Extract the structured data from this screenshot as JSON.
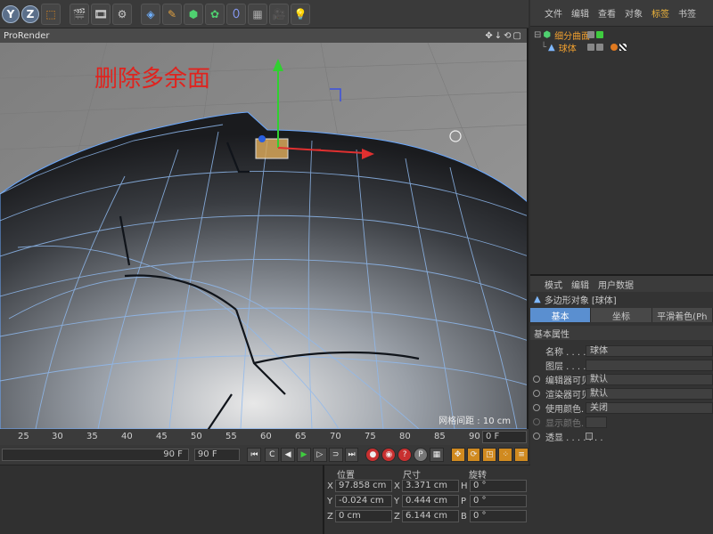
{
  "toolbar": {
    "buttons": [
      {
        "name": "y-axis-lock-button",
        "label": "Y"
      },
      {
        "name": "z-axis-lock-button",
        "label": "Z"
      }
    ]
  },
  "viewport": {
    "title": "ProRender",
    "nav_icons": "✥↓⟲▢",
    "annotation": "删除多余面",
    "grid_spacing": "网格间距 : 10 cm"
  },
  "object_manager": {
    "menu": [
      "文件",
      "编辑",
      "查看",
      "对象",
      "标签",
      "书签"
    ],
    "active_menu": "标签",
    "objects": [
      {
        "name": "细分曲面",
        "level": 0
      },
      {
        "name": "球体",
        "level": 1
      }
    ]
  },
  "attribute_manager": {
    "menu": [
      "模式",
      "编辑",
      "用户数据"
    ],
    "object_title": "多边形对象 [球体]",
    "tabs": [
      "基本",
      "坐标",
      "平滑着色(Ph"
    ],
    "active_tab": "基本",
    "section": "基本属性",
    "rows": [
      {
        "label": "名称 . . . . . . .",
        "value": "球体",
        "radio": false,
        "dim": false
      },
      {
        "label": "图层 . . . . . . .",
        "value": "",
        "radio": false,
        "dim": false
      },
      {
        "label": "编辑器可见",
        "value": "默认",
        "radio": true,
        "dim": false
      },
      {
        "label": "渲染器可见",
        "value": "默认",
        "radio": true,
        "dim": false
      },
      {
        "label": "使用颜色. . . .",
        "value": "关闭",
        "radio": true,
        "dim": false
      },
      {
        "label": "显示颜色. . . .",
        "value": "",
        "radio": true,
        "dim": true
      },
      {
        "label": "透显 . . . . . . .",
        "value": "",
        "radio": true,
        "dim": false
      }
    ]
  },
  "timeline": {
    "ticks": [
      "25",
      "30",
      "35",
      "40",
      "45",
      "50",
      "55",
      "60",
      "65",
      "70",
      "75",
      "80",
      "85",
      "90"
    ],
    "current_frame": "0 F"
  },
  "playback": {
    "range_end": "90 F",
    "max_frame": "90 F"
  },
  "coordinates": {
    "headers": {
      "position": "位置",
      "size": "尺寸",
      "rotation": "旋转"
    },
    "rows": [
      {
        "axis": "X",
        "pos": "97.858 cm",
        "size_axis": "X",
        "size": "3.371 cm",
        "rot_axis": "H",
        "rot": "0 °"
      },
      {
        "axis": "Y",
        "pos": "-0.024 cm",
        "size_axis": "Y",
        "size": "0.444 cm",
        "rot_axis": "P",
        "rot": "0 °"
      },
      {
        "axis": "Z",
        "pos": "0 cm",
        "size_axis": "Z",
        "size": "6.144 cm",
        "rot_axis": "B",
        "rot": "0 °"
      }
    ]
  },
  "colors": {
    "accent_orange": "#f0a030",
    "annotation_red": "#e0231e",
    "tab_blue": "#5a8fd0",
    "viewport_bg": "#8c8c8c"
  }
}
